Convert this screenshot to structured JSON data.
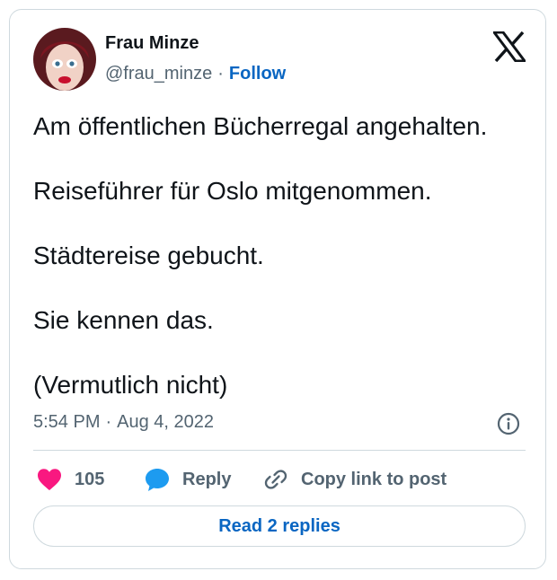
{
  "author": {
    "name": "Frau Minze",
    "handle": "@frau_minze",
    "separator": "·",
    "follow_label": "Follow"
  },
  "icons": {
    "platform_logo": "x-logo-icon",
    "info": "info-icon",
    "like": "heart-icon",
    "reply": "speech-bubble-icon",
    "copy_link": "link-icon"
  },
  "tweet": {
    "paragraphs": [
      "Am öffentlichen Bücherregal angehalten.",
      "Reiseführer für Oslo mitgenommen.",
      "Städtereise gebucht.",
      "Sie kennen das.",
      "(Vermutlich nicht)"
    ],
    "time": "5:54 PM",
    "date": "Aug 4, 2022",
    "meta_separator": "·"
  },
  "actions": {
    "like_count": "105",
    "reply_label": "Reply",
    "copy_link_label": "Copy link to post",
    "read_replies_label": "Read 2 replies"
  },
  "colors": {
    "accent": "#0a66c2",
    "like": "#f91880",
    "reply_icon": "#1d9bf0",
    "text": "#0f1419",
    "muted": "#536471",
    "border": "#cfd9de"
  }
}
